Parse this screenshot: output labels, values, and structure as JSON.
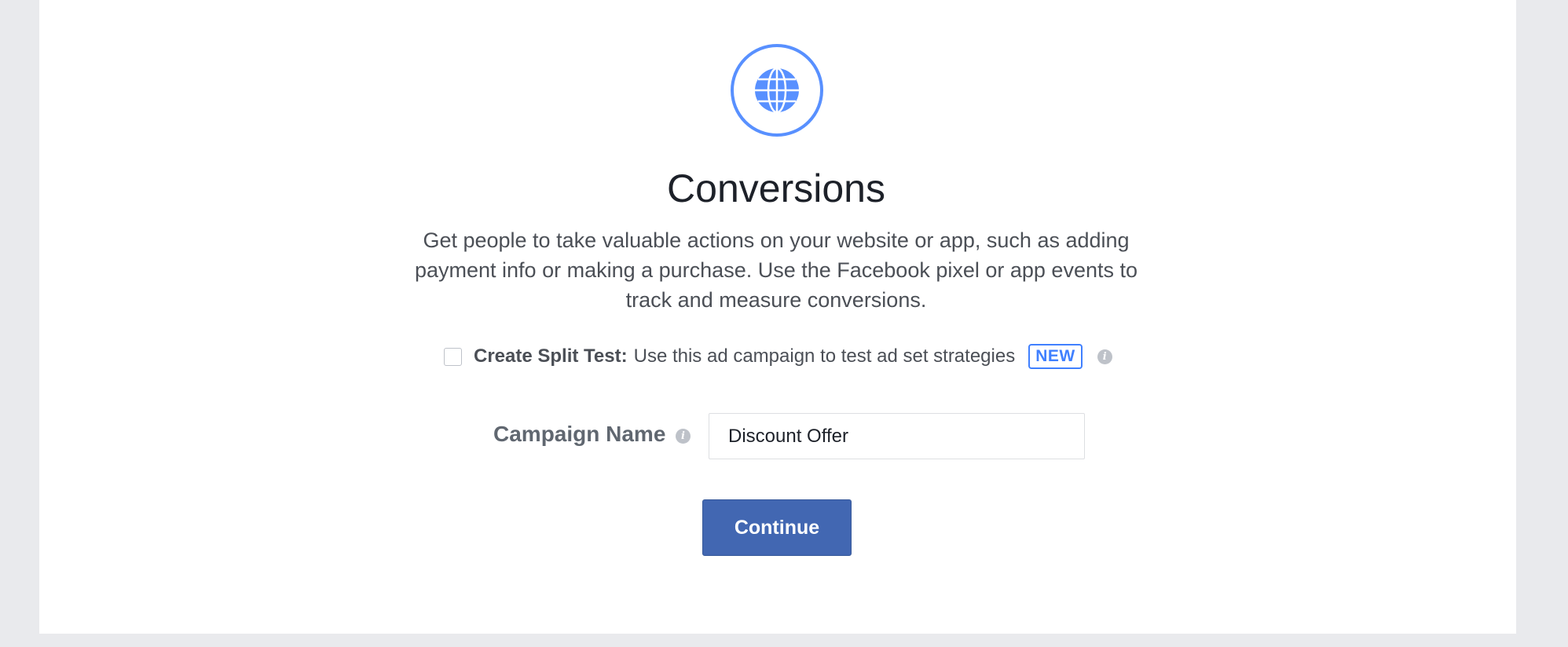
{
  "objective": {
    "icon": "globe-icon",
    "title": "Conversions",
    "description": "Get people to take valuable actions on your website or app, such as adding payment info or making a purchase. Use the Facebook pixel or app events to track and measure conversions."
  },
  "split_test": {
    "checked": false,
    "label_strong": "Create Split Test:",
    "label_text": "Use this ad campaign to test ad set strategies",
    "badge": "NEW",
    "info_icon": "info-icon"
  },
  "campaign_name": {
    "label": "Campaign Name",
    "info_icon": "info-icon",
    "value": "Discount Offer"
  },
  "continue_button": {
    "label": "Continue"
  },
  "colors": {
    "accent_blue": "#4080ff",
    "button_blue": "#4267b2",
    "page_background": "#e9eaed"
  }
}
